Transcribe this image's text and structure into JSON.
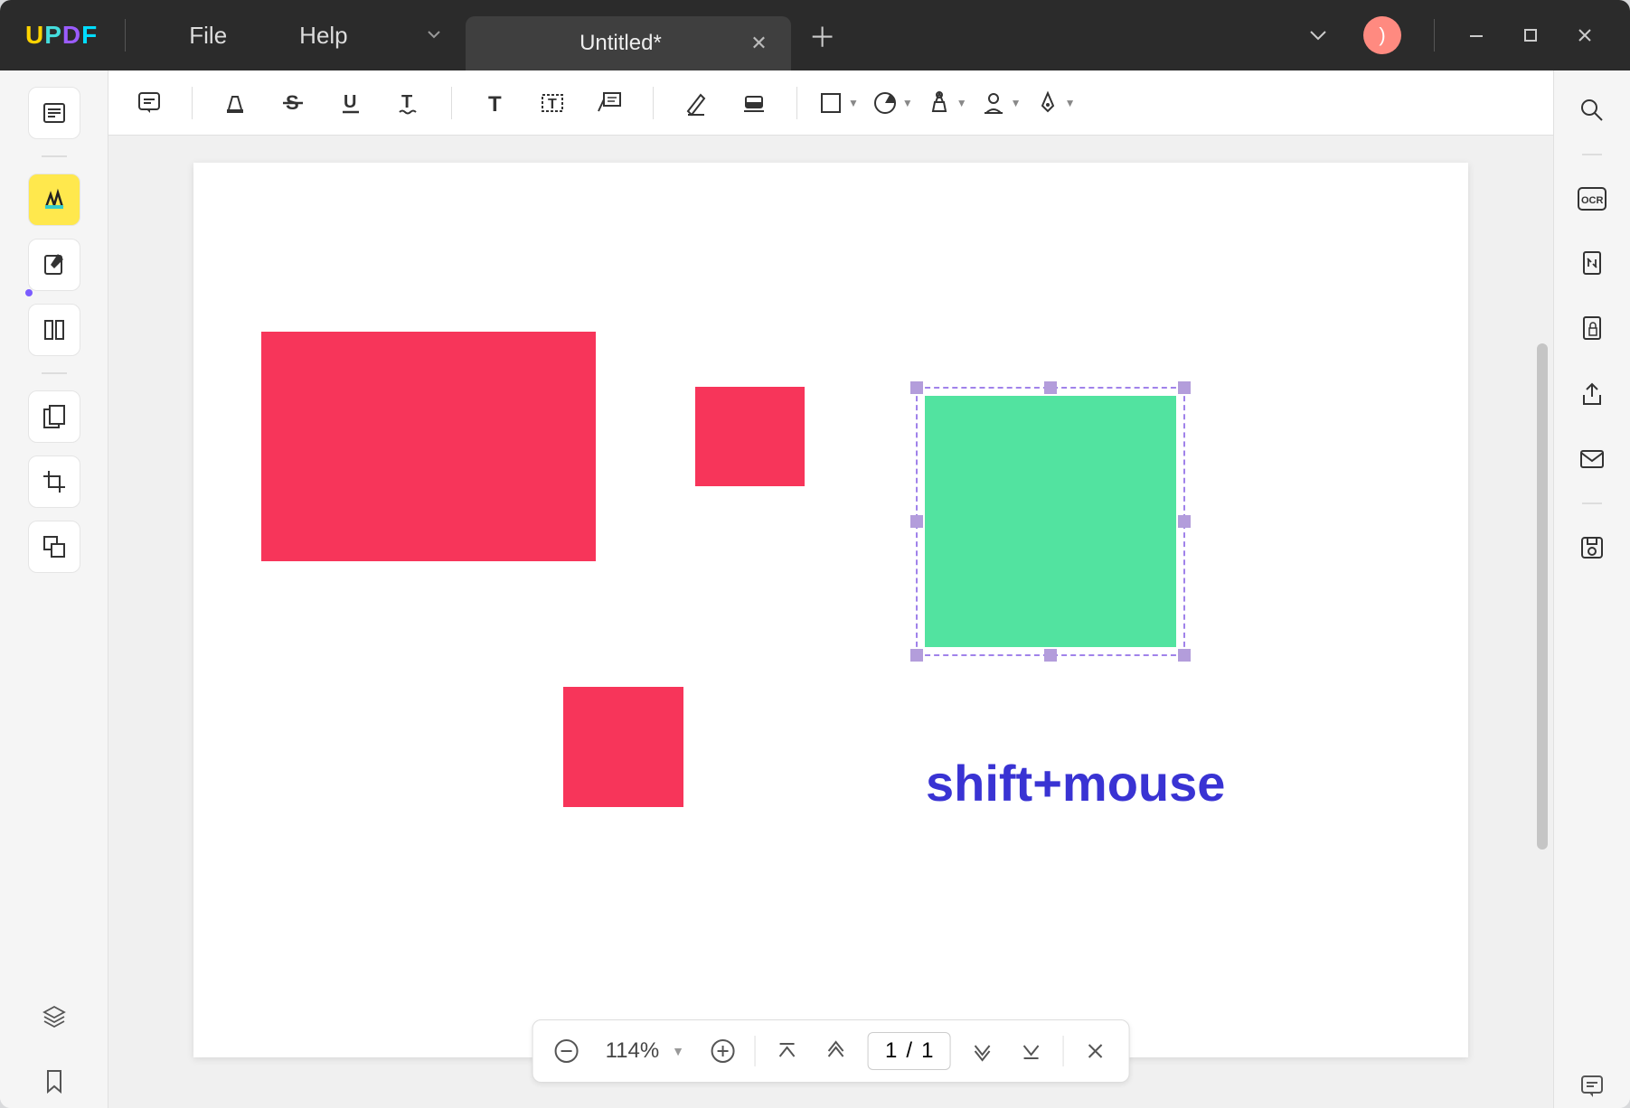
{
  "titlebar": {
    "logo": "UPDF",
    "menus": {
      "file": "File",
      "help": "Help"
    },
    "tab": {
      "title": "Untitled*"
    }
  },
  "bottom": {
    "zoom": "114%",
    "page_current": "1",
    "page_sep": "/",
    "page_total": "1"
  },
  "canvas": {
    "ocr_label": "OCR",
    "annotation": "shift+mouse"
  },
  "colors": {
    "pink": "#f7355a",
    "green": "#52e3a0",
    "blue_text": "#3933d3",
    "selection": "#a082ea"
  }
}
